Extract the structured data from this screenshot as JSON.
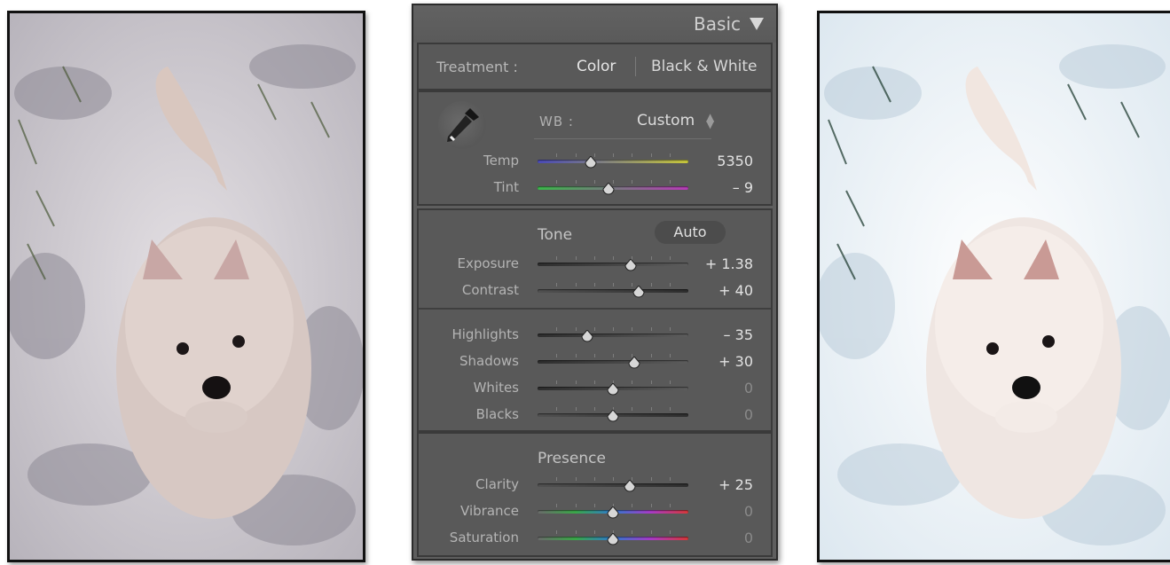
{
  "panel": {
    "title": "Basic",
    "treatment": {
      "label": "Treatment :",
      "color": "Color",
      "black_white": "Black & White"
    },
    "white_balance": {
      "label": "WB :",
      "value": "Custom",
      "sliders": [
        {
          "name": "temp",
          "label": "Temp",
          "value": "5350",
          "position": 0.35,
          "track": "temp"
        },
        {
          "name": "tint",
          "label": "Tint",
          "value": "– 9",
          "position": 0.47,
          "track": "tint"
        }
      ]
    },
    "tone": {
      "label": "Tone",
      "auto_label": "Auto",
      "sliders": [
        {
          "name": "exposure",
          "label": "Exposure",
          "value": "+ 1.38",
          "position": 0.62,
          "track": "gray"
        },
        {
          "name": "contrast",
          "label": "Contrast",
          "value": "+ 40",
          "position": 0.67,
          "track": "dark"
        },
        {
          "name": "highlights",
          "label": "Highlights",
          "value": "– 35",
          "position": 0.33,
          "track": "gray"
        },
        {
          "name": "shadows",
          "label": "Shadows",
          "value": "+ 30",
          "position": 0.64,
          "track": "gray"
        },
        {
          "name": "whites",
          "label": "Whites",
          "value": "0",
          "position": 0.5,
          "track": "gray"
        },
        {
          "name": "blacks",
          "label": "Blacks",
          "value": "0",
          "position": 0.5,
          "track": "dark"
        }
      ]
    },
    "presence": {
      "label": "Presence",
      "sliders": [
        {
          "name": "clarity",
          "label": "Clarity",
          "value": "+ 25",
          "position": 0.61,
          "track": "dark"
        },
        {
          "name": "vibrance",
          "label": "Vibrance",
          "value": "0",
          "position": 0.5,
          "track": "sat"
        },
        {
          "name": "saturation",
          "label": "Saturation",
          "value": "0",
          "position": 0.5,
          "track": "sat"
        }
      ]
    }
  },
  "colors": {
    "panel_bg": "#5e5e5e",
    "text_light": "#e2e2e2",
    "temp_track": [
      "#4a4ab8",
      "#c8c83a"
    ],
    "tint_track": [
      "#3ab84a",
      "#b83ab8"
    ],
    "saturation_track": [
      "#6a6a6a",
      "#d83838"
    ]
  },
  "images": {
    "before": {
      "icon": "dog-in-snow-photo-warm"
    },
    "after": {
      "icon": "dog-in-snow-photo-cool-bright"
    }
  }
}
